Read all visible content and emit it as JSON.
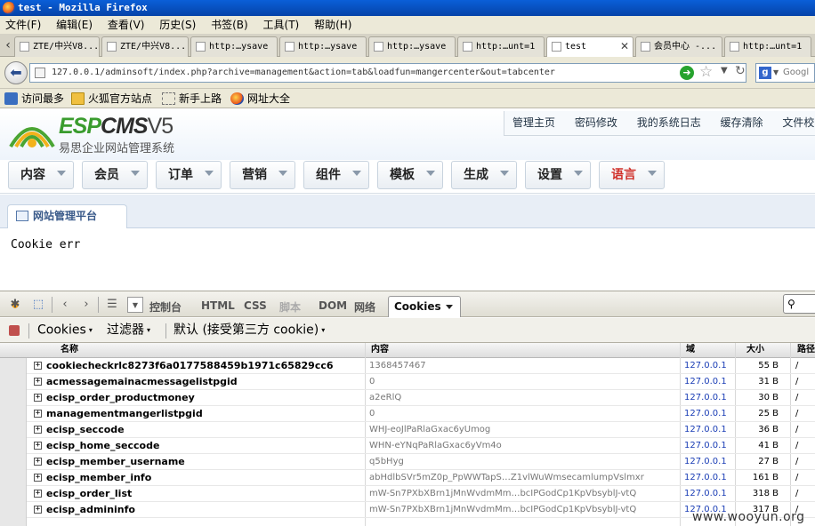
{
  "window": {
    "title": "test - Mozilla Firefox"
  },
  "menu": [
    "文件(F)",
    "编辑(E)",
    "查看(V)",
    "历史(S)",
    "书签(B)",
    "工具(T)",
    "帮助(H)"
  ],
  "tabs": [
    {
      "label": "ZTE/中兴V8..."
    },
    {
      "label": "ZTE/中兴V8..."
    },
    {
      "label": "http:…ysave"
    },
    {
      "label": "http:…ysave"
    },
    {
      "label": "http:…ysave"
    },
    {
      "label": "http:…unt=1"
    },
    {
      "label": "test"
    },
    {
      "label": "会员中心 -..."
    },
    {
      "label": "http:…unt=1"
    }
  ],
  "url": "127.0.0.1/adminsoft/index.php?archive=management&action=tab&loadfun=mangercenter&out=tabcenter",
  "search": {
    "placeholder": "Googl"
  },
  "bookmarks": [
    "访问最多",
    "火狐官方站点",
    "新手上路",
    "网址大全"
  ],
  "cms": {
    "logo_esp": "ESP",
    "logo_cms": "CMS",
    "logo_ver": "V5",
    "logo_subtitle": "易思企业网站管理系统",
    "top_links": [
      "管理主页",
      "密码修改",
      "我的系统日志",
      "缓存清除",
      "文件校"
    ],
    "nav": [
      "内容",
      "会员",
      "订单",
      "营销",
      "组件",
      "模板",
      "生成",
      "设置",
      "语言"
    ],
    "subtab": "网站管理平台",
    "message": "Cookie err"
  },
  "firebug": {
    "tabs": [
      "控制台",
      "HTML",
      "CSS",
      "脚本",
      "DOM",
      "网络",
      "Cookies"
    ],
    "sub_items": [
      "Cookies",
      "过滤器",
      "默认 (接受第三方 cookie)"
    ],
    "columns": {
      "name": "名称",
      "value": "内容",
      "domain": "域",
      "size": "大小",
      "path": "路径"
    },
    "cookies": [
      {
        "name": "cookiecheckrlc8273f6a0177588459b1971c65829cc6",
        "value": "1368457467",
        "domain": "127.0.0.1",
        "size": "55 B",
        "path": "/"
      },
      {
        "name": "acmessagemainacmessagelistpgid",
        "value": "0",
        "domain": "127.0.0.1",
        "size": "31 B",
        "path": "/"
      },
      {
        "name": "ecisp_order_productmoney",
        "value": "a2eRlQ",
        "domain": "127.0.0.1",
        "size": "30 B",
        "path": "/"
      },
      {
        "name": "managementmangerlistpgid",
        "value": "0",
        "domain": "127.0.0.1",
        "size": "25 B",
        "path": "/"
      },
      {
        "name": "ecisp_seccode",
        "value": "WHJ-eoJlPaRlaGxac6yUmog",
        "domain": "127.0.0.1",
        "size": "36 B",
        "path": "/"
      },
      {
        "name": "ecisp_home_seccode",
        "value": "WHN-eYNqPaRlaGxac6yVm4o",
        "domain": "127.0.0.1",
        "size": "41 B",
        "path": "/"
      },
      {
        "name": "ecisp_member_username",
        "value": "q5bHyg",
        "domain": "127.0.0.1",
        "size": "27 B",
        "path": "/"
      },
      {
        "name": "ecisp_member_info",
        "value": "abHdlbSVr5mZ0p_PpWWTapS…Z1vlWuWmsecamlumpVslmxr",
        "domain": "127.0.0.1",
        "size": "161 B",
        "path": "/"
      },
      {
        "name": "ecisp_order_list",
        "value": "mW-Sn7PXbXBrn1jMnWvdmMm…bcIPGodCp1KpVbsyblJ-vtQ",
        "domain": "127.0.0.1",
        "size": "318 B",
        "path": "/"
      },
      {
        "name": "ecisp_admininfo",
        "value": "mW-Sn7PXbXBrn1jMnWvdmMm…bcIPGodCp1KpVbsyblJ-vtQ",
        "domain": "127.0.0.1",
        "size": "317 B",
        "path": "/"
      }
    ]
  },
  "watermark": "www.wooyun.org"
}
